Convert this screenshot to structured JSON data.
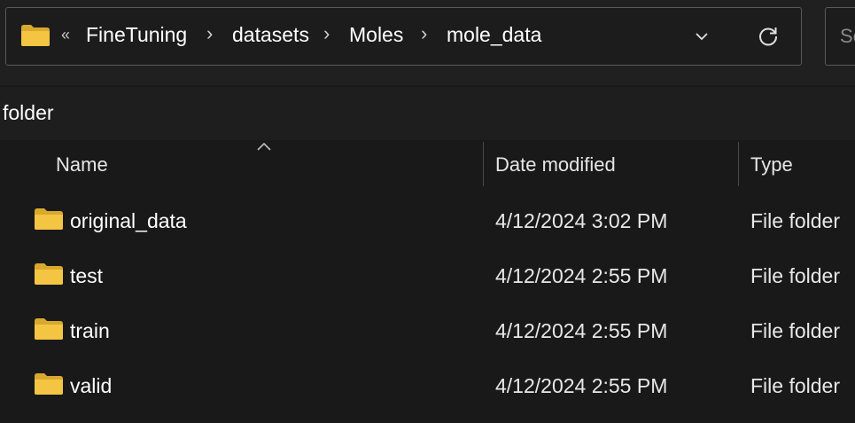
{
  "address_bar": {
    "overflow_chevrons": "«",
    "breadcrumbs": [
      "FineTuning",
      "datasets",
      "Moles",
      "mole_data"
    ],
    "separator": "›"
  },
  "search": {
    "placeholder": "Se"
  },
  "typing_row": {
    "text": "folder"
  },
  "columns": {
    "name": "Name",
    "date_modified": "Date modified",
    "type": "Type"
  },
  "sort": {
    "column": "name",
    "direction": "ascending"
  },
  "files": [
    {
      "name": "original_data",
      "date_modified": "4/12/2024 3:02 PM",
      "type": "File folder"
    },
    {
      "name": "test",
      "date_modified": "4/12/2024 2:55 PM",
      "type": "File folder"
    },
    {
      "name": "train",
      "date_modified": "4/12/2024 2:55 PM",
      "type": "File folder"
    },
    {
      "name": "valid",
      "date_modified": "4/12/2024 2:55 PM",
      "type": "File folder"
    }
  ],
  "icons": {
    "address_folder": "folder-icon",
    "history_dropdown": "chevron-down-icon",
    "refresh": "refresh-icon",
    "sort_indicator": "sort-up-icon",
    "row_folder": "folder-icon"
  },
  "colors": {
    "background": "#191919",
    "toolbar": "#202020",
    "folder_yellow": "#f4c542",
    "border": "#5a5a5a"
  }
}
